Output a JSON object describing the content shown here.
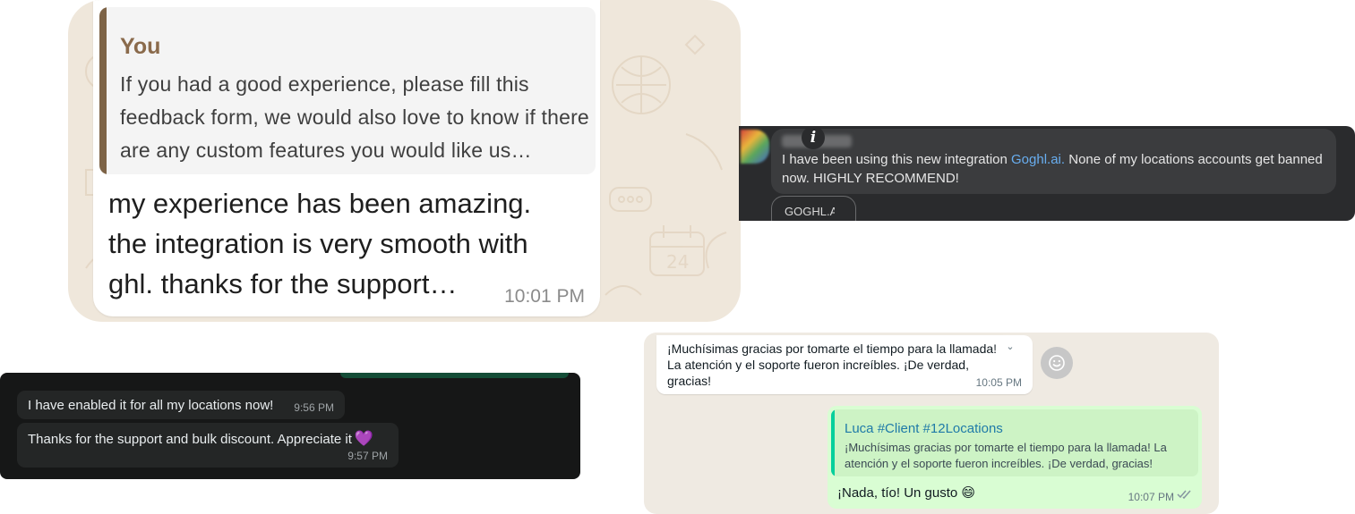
{
  "panel1": {
    "quote_author": "You",
    "quote_text": "If you had a good experience, please fill this feedback form, we would also love to know if there are any custom features you would like us…",
    "message": "my experience has been amazing. the integration is very smooth with ghl. thanks for the support…",
    "time": "10:01 PM"
  },
  "panel2": {
    "comment_before": "I have been using this new integration ",
    "comment_link": "Goghl.ai.",
    "comment_after": " None of my locations accounts get banned now. HIGHLY RECOMMEND!",
    "chip_label": "GOGHL.AI",
    "info_icon_glyph": "i",
    "colors": {
      "link": "#68aef0",
      "background": "#2a2b2d"
    }
  },
  "panel3": {
    "messages": [
      {
        "text": "I have enabled it for all my locations now!",
        "time": "9:56 PM"
      },
      {
        "text": "Thanks for the support and bulk discount. Appreciate it",
        "emoji": "💜",
        "time": "9:57 PM"
      }
    ]
  },
  "panel4": {
    "incoming": {
      "line1": "¡Muchísimas gracias por tomarte el tiempo para la llamada!",
      "line2": "La atención y el soporte fueron increíbles. ¡De verdad, gracias!",
      "time": "10:05 PM",
      "chevron": "⌄"
    },
    "outgoing": {
      "quote_author": "Luca #Client #12Locations",
      "quote_text": "¡Muchísimas gracias por tomarte el tiempo para la llamada! La atención y el soporte fueron increíbles. ¡De verdad, gracias!",
      "message": "¡Nada, tío! Un gusto",
      "emoji": "😄",
      "time": "10:07 PM"
    },
    "colors": {
      "outgoing_bubble": "#d9fdd3",
      "quote_author": "#1f7aa8",
      "background": "#efeae2"
    }
  }
}
